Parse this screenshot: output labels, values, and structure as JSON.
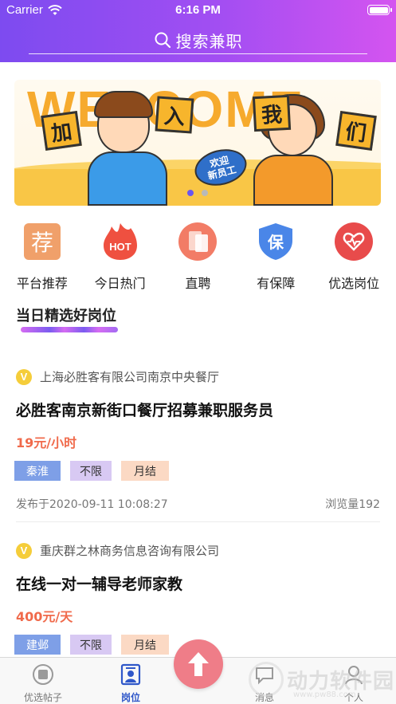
{
  "status_bar": {
    "carrier": "Carrier",
    "time": "6:16 PM"
  },
  "search": {
    "label": "搜索兼职"
  },
  "banner": {
    "welcome_text": "WELCOME",
    "tiles": [
      "加",
      "入",
      "我",
      "们"
    ],
    "bubble_line1": "欢迎",
    "bubble_line2": "新员工",
    "page_count": 2,
    "active_page": 1
  },
  "categories": [
    {
      "label": "平台推荐",
      "icon": "recommend-icon",
      "glyph": "荐",
      "color": "#f0a06a"
    },
    {
      "label": "今日热门",
      "icon": "hot-icon",
      "glyph": "HOT",
      "color": "#ef5040"
    },
    {
      "label": "直聘",
      "icon": "direct-hire-icon",
      "glyph": "",
      "color": "#f27c66"
    },
    {
      "label": "有保障",
      "icon": "guarantee-icon",
      "glyph": "保",
      "color": "#4a86e8"
    },
    {
      "label": "优选岗位",
      "icon": "featured-job-icon",
      "glyph": "",
      "color": "#e84b4b"
    }
  ],
  "section": {
    "title": "当日精选好岗位"
  },
  "jobs": [
    {
      "company": "上海必胜客有限公司南京中央餐厅",
      "title": "必胜客南京新街口餐厅招募兼职服务员",
      "salary": "19元/小时",
      "tags": {
        "location": "秦淮",
        "limit": "不限",
        "pay": "月结"
      },
      "published": "发布于2020-09-11 10:08:27",
      "views": "浏览量192"
    },
    {
      "company": "重庆群之林商务信息咨询有限公司",
      "title": "在线一对一辅导老师家教",
      "salary": "400元/天",
      "tags": {
        "location": "建邺",
        "limit": "不限",
        "pay": "月结"
      }
    }
  ],
  "tabbar": {
    "tabs": [
      {
        "label": "优选帖子",
        "icon": "post-icon"
      },
      {
        "label": "岗位",
        "icon": "job-icon",
        "active": true
      },
      {
        "label": "消息",
        "icon": "message-icon"
      },
      {
        "label": "个人",
        "icon": "profile-icon"
      }
    ],
    "fab_icon": "upload-arrow-icon"
  },
  "watermark": {
    "text": "动力软件园",
    "url": "www.pw88.com"
  },
  "colors": {
    "header_start": "#7d4bf0",
    "header_end": "#d454f0",
    "salary": "#f06a4b",
    "active_tab": "#2f57c9",
    "fab": "#ef7d88"
  }
}
